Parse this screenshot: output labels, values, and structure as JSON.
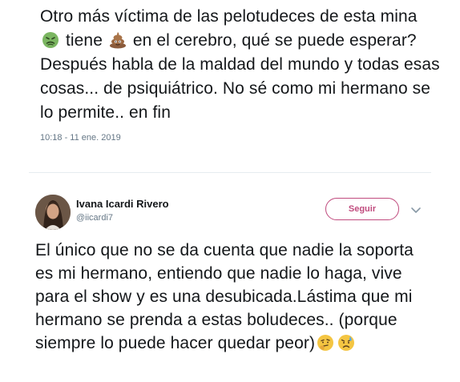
{
  "top_tweet": {
    "text_part1": "Otro más víctima de las pelotudeces de esta mina",
    "text_part2": "tiene",
    "text_part3": "en el cerebro, qué se puede esperar? Después habla de la maldad del mundo y todas esas cosas... de psiquiátrico. No sé como mi hermano se lo permite.. en fin",
    "emoji1": "nauseated-face-icon",
    "emoji2": "pile-of-poo-icon",
    "timestamp": "10:18 - 11 ene. 2019"
  },
  "reply": {
    "display_name": "Ivana Icardi Rivero",
    "handle": "@iicardi7",
    "follow_label": "Seguir",
    "text": "El único que no se da cuenta que nadie la soporta es mi hermano, entiendo que nadie lo haga, vive para el show y es una desubicada.Lástima que mi hermano se prenda a estas boludeces.. (porque siempre lo puede hacer quedar peor)",
    "emoji1": "thinking-face-icon",
    "emoji2": "sad-sweat-face-icon",
    "accent_color": "#c04b7e"
  }
}
